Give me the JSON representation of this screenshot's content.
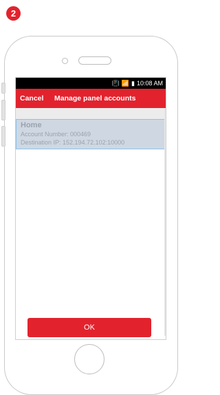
{
  "step_badge": "2",
  "status_bar": {
    "time": "10:08 AM",
    "icons": [
      "vibrate-icon",
      "wifi-icon",
      "signal-icon",
      "battery-icon"
    ]
  },
  "app_bar": {
    "cancel_label": "Cancel",
    "title": "Manage panel accounts"
  },
  "accounts": [
    {
      "name": "Home",
      "account_number": "Account Number: 000469",
      "destination_ip": "Destination IP: 152.194.72.102:10000"
    }
  ],
  "ok_label": "OK",
  "colors": {
    "accent": "#e2232e",
    "selected_bg": "#cfd8e2",
    "selected_border": "#8cc2ee"
  }
}
